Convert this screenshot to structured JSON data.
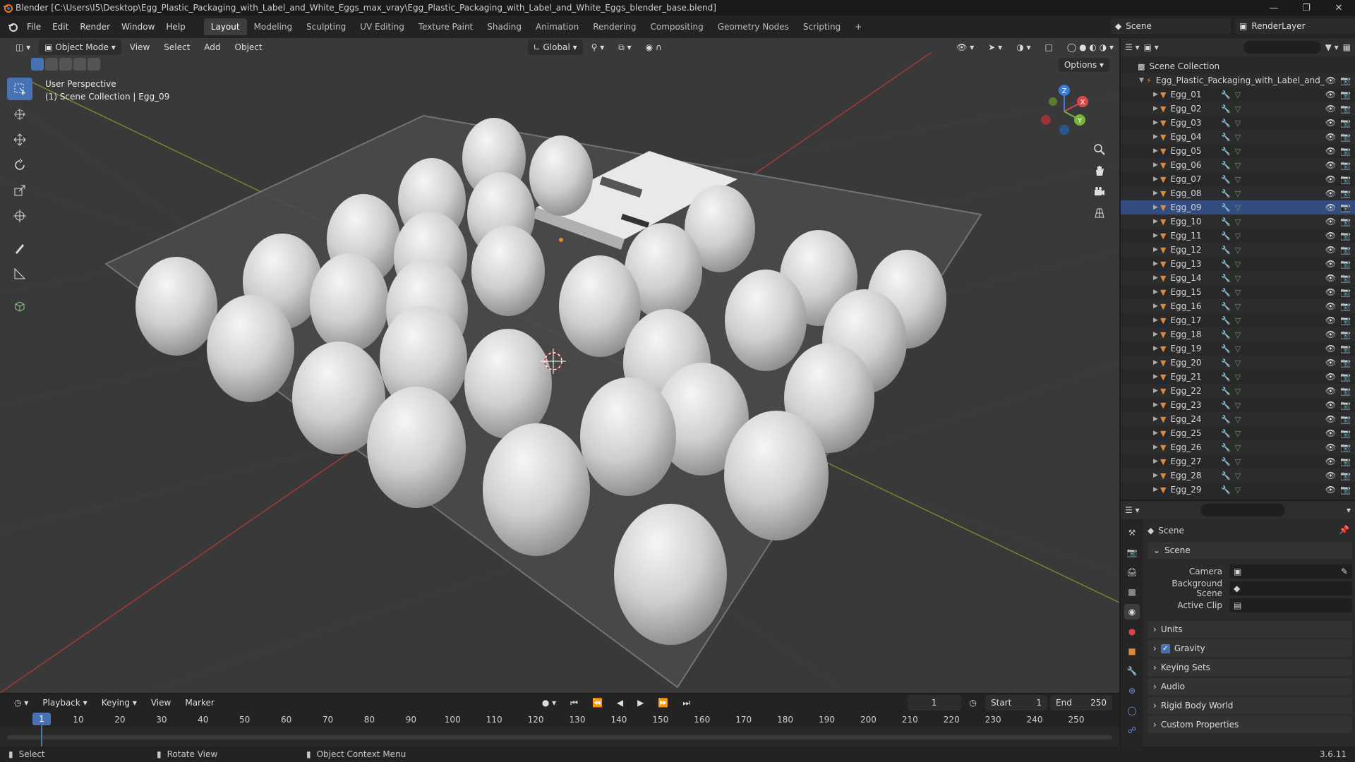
{
  "window": {
    "title": "Blender [C:\\Users\\I5\\Desktop\\Egg_Plastic_Packaging_with_Label_and_White_Eggs_max_vray\\Egg_Plastic_Packaging_with_Label_and_White_Eggs_blender_base.blend]"
  },
  "menu": [
    "File",
    "Edit",
    "Render",
    "Window",
    "Help"
  ],
  "workspaces": [
    "Layout",
    "Modeling",
    "Sculpting",
    "UV Editing",
    "Texture Paint",
    "Shading",
    "Animation",
    "Rendering",
    "Compositing",
    "Geometry Nodes",
    "Scripting"
  ],
  "workspace_add": "+",
  "scene_field": "Scene",
  "renderlayer_field": "RenderLayer",
  "viewport": {
    "mode": "Object Mode",
    "menus": [
      "View",
      "Select",
      "Add",
      "Object"
    ],
    "transform": "Global",
    "options": "Options",
    "info_line1": "User Perspective",
    "info_line2": "(1) Scene Collection | Egg_09",
    "gizmo_axes": {
      "x": "X",
      "y": "Y",
      "z": "Z"
    }
  },
  "outliner": {
    "root": "Scene Collection",
    "collection": "Egg_Plastic_Packaging_with_Label_and_",
    "items": [
      "Egg_01",
      "Egg_02",
      "Egg_03",
      "Egg_04",
      "Egg_05",
      "Egg_06",
      "Egg_07",
      "Egg_08",
      "Egg_09",
      "Egg_10",
      "Egg_11",
      "Egg_12",
      "Egg_13",
      "Egg_14",
      "Egg_15",
      "Egg_16",
      "Egg_17",
      "Egg_18",
      "Egg_19",
      "Egg_20",
      "Egg_21",
      "Egg_22",
      "Egg_23",
      "Egg_24",
      "Egg_25",
      "Egg_26",
      "Egg_27",
      "Egg_28",
      "Egg_29"
    ],
    "active_item": "Egg_09"
  },
  "properties": {
    "context": "Scene",
    "panel_scene": "Scene",
    "camera_label": "Camera",
    "bg_scene_label": "Background Scene",
    "active_clip_label": "Active Clip",
    "panels": [
      "Units",
      "Gravity",
      "Keying Sets",
      "Audio",
      "Rigid Body World",
      "Custom Properties"
    ],
    "gravity_checked": true
  },
  "timeline": {
    "menus": [
      "Playback",
      "Keying",
      "View",
      "Marker"
    ],
    "current_frame": "1",
    "start_label": "Start",
    "start_value": "1",
    "end_label": "End",
    "end_value": "250",
    "ruler": [
      "10",
      "20",
      "30",
      "40",
      "50",
      "60",
      "70",
      "80",
      "90",
      "100",
      "110",
      "120",
      "130",
      "140",
      "150",
      "160",
      "170",
      "180",
      "190",
      "200",
      "210",
      "220",
      "230",
      "240",
      "250"
    ],
    "playhead_label": "1"
  },
  "status": {
    "select": "Select",
    "rotate": "Rotate View",
    "context_menu": "Object Context Menu",
    "version": "3.6.11"
  },
  "colors": {
    "accent": "#4772b3",
    "object_orange": "#e08a35",
    "mesh_green": "#5ea85e",
    "mod_blue": "#6d8fd6"
  }
}
